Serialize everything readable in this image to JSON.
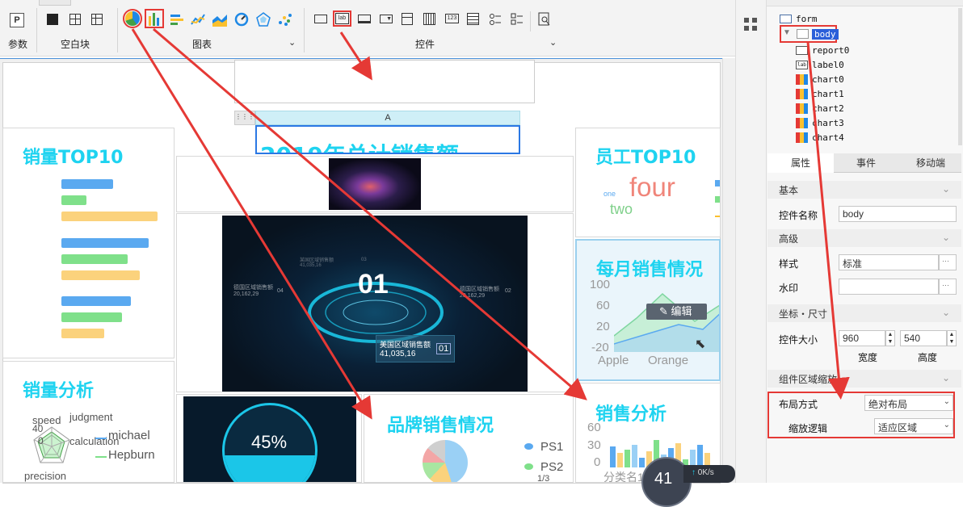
{
  "toolbar": {
    "groups": [
      {
        "label": "参数"
      },
      {
        "label": "空白块"
      },
      {
        "label": "图表"
      },
      {
        "label": "控件"
      }
    ],
    "icons": {
      "param": "P",
      "label_widget": "lab",
      "number_widget": "123"
    }
  },
  "canvas": {
    "report_column": "A",
    "report_text": "2019年总计销售额",
    "panels": {
      "sales_top10": {
        "title": "销量TOP10",
        "bars": [
          {
            "color": "#5aa9f0",
            "value": 64
          },
          {
            "color": "#7fe08a",
            "value": 31
          },
          {
            "color": "#fbd27c",
            "value": 119
          },
          {
            "color": "#5aa9f0",
            "value": 108
          },
          {
            "color": "#7fe08a",
            "value": 82
          },
          {
            "color": "#fbd27c",
            "value": 97
          },
          {
            "color": "#5aa9f0",
            "value": 86
          },
          {
            "color": "#7fe08a",
            "value": 75
          },
          {
            "color": "#fbd27c",
            "value": 53
          }
        ]
      },
      "sales_analysis_left": {
        "title": "销量分析",
        "radar_labels": [
          "speed",
          "judgment",
          "calculation",
          "precision"
        ],
        "radar_values": [
          "40",
          "0"
        ],
        "legend": [
          "michael",
          "Hepburn"
        ]
      },
      "staff_top10": {
        "title": "员工TOP10",
        "words": [
          "four",
          "one",
          "two"
        ]
      },
      "monthly_sales": {
        "title": "每月销售情况",
        "y_ticks": [
          "100",
          "60",
          "20",
          "-20"
        ],
        "x_ticks": [
          "Apple",
          "Orange"
        ],
        "edit_label": "编辑"
      },
      "brand_sales": {
        "title": "品牌销售情况",
        "legend": [
          "PS1",
          "PS2"
        ],
        "page": "1/3"
      },
      "sales_analysis_right": {
        "title": "销售分析",
        "y_ticks": [
          "60",
          "30",
          "0"
        ],
        "x_label": "分类名1"
      },
      "dashboard": {
        "center": "01",
        "card_label": "美国区域销售额",
        "card_value": "41,035,16",
        "card_num": "01",
        "left_label": "德国区域销售额",
        "left_value": "20,162,29",
        "left_num": "04",
        "top_label": "某国区域销售额",
        "top_value": "41,035,16",
        "top_num": "03",
        "right_label": "德国区域销售额",
        "right_value": "20,162,29",
        "right_num": "02"
      },
      "gauge": {
        "value": "45%",
        "fill_fraction": 0.45
      },
      "speed": {
        "value": "41",
        "net": "0K/s"
      }
    }
  },
  "tree": {
    "items": [
      "form",
      "body",
      "report0",
      "label0",
      "chart0",
      "chart1",
      "chart2",
      "chart3",
      "chart4"
    ]
  },
  "props": {
    "tabs": [
      "属性",
      "事件",
      "移动端"
    ],
    "sections": {
      "basic": "基本",
      "advanced": "高级",
      "coord": "坐标・尺寸",
      "zoom": "组件区域缩放"
    },
    "widget_name_label": "控件名称",
    "widget_name_value": "body",
    "style_label": "样式",
    "style_value": "标准",
    "watermark_label": "水印",
    "size_label": "控件大小",
    "width_value": "960",
    "height_value": "540",
    "width_label": "宽度",
    "height_label": "高度",
    "layout_label": "布局方式",
    "layout_value": "绝对布局",
    "scale_label": "缩放逻辑",
    "scale_value": "适应区域",
    "ellipsis": "···"
  },
  "colors": {
    "title_cyan": "#1ed3f0",
    "highlight_red": "#e53935",
    "selection_blue": "#2b5fd9"
  }
}
